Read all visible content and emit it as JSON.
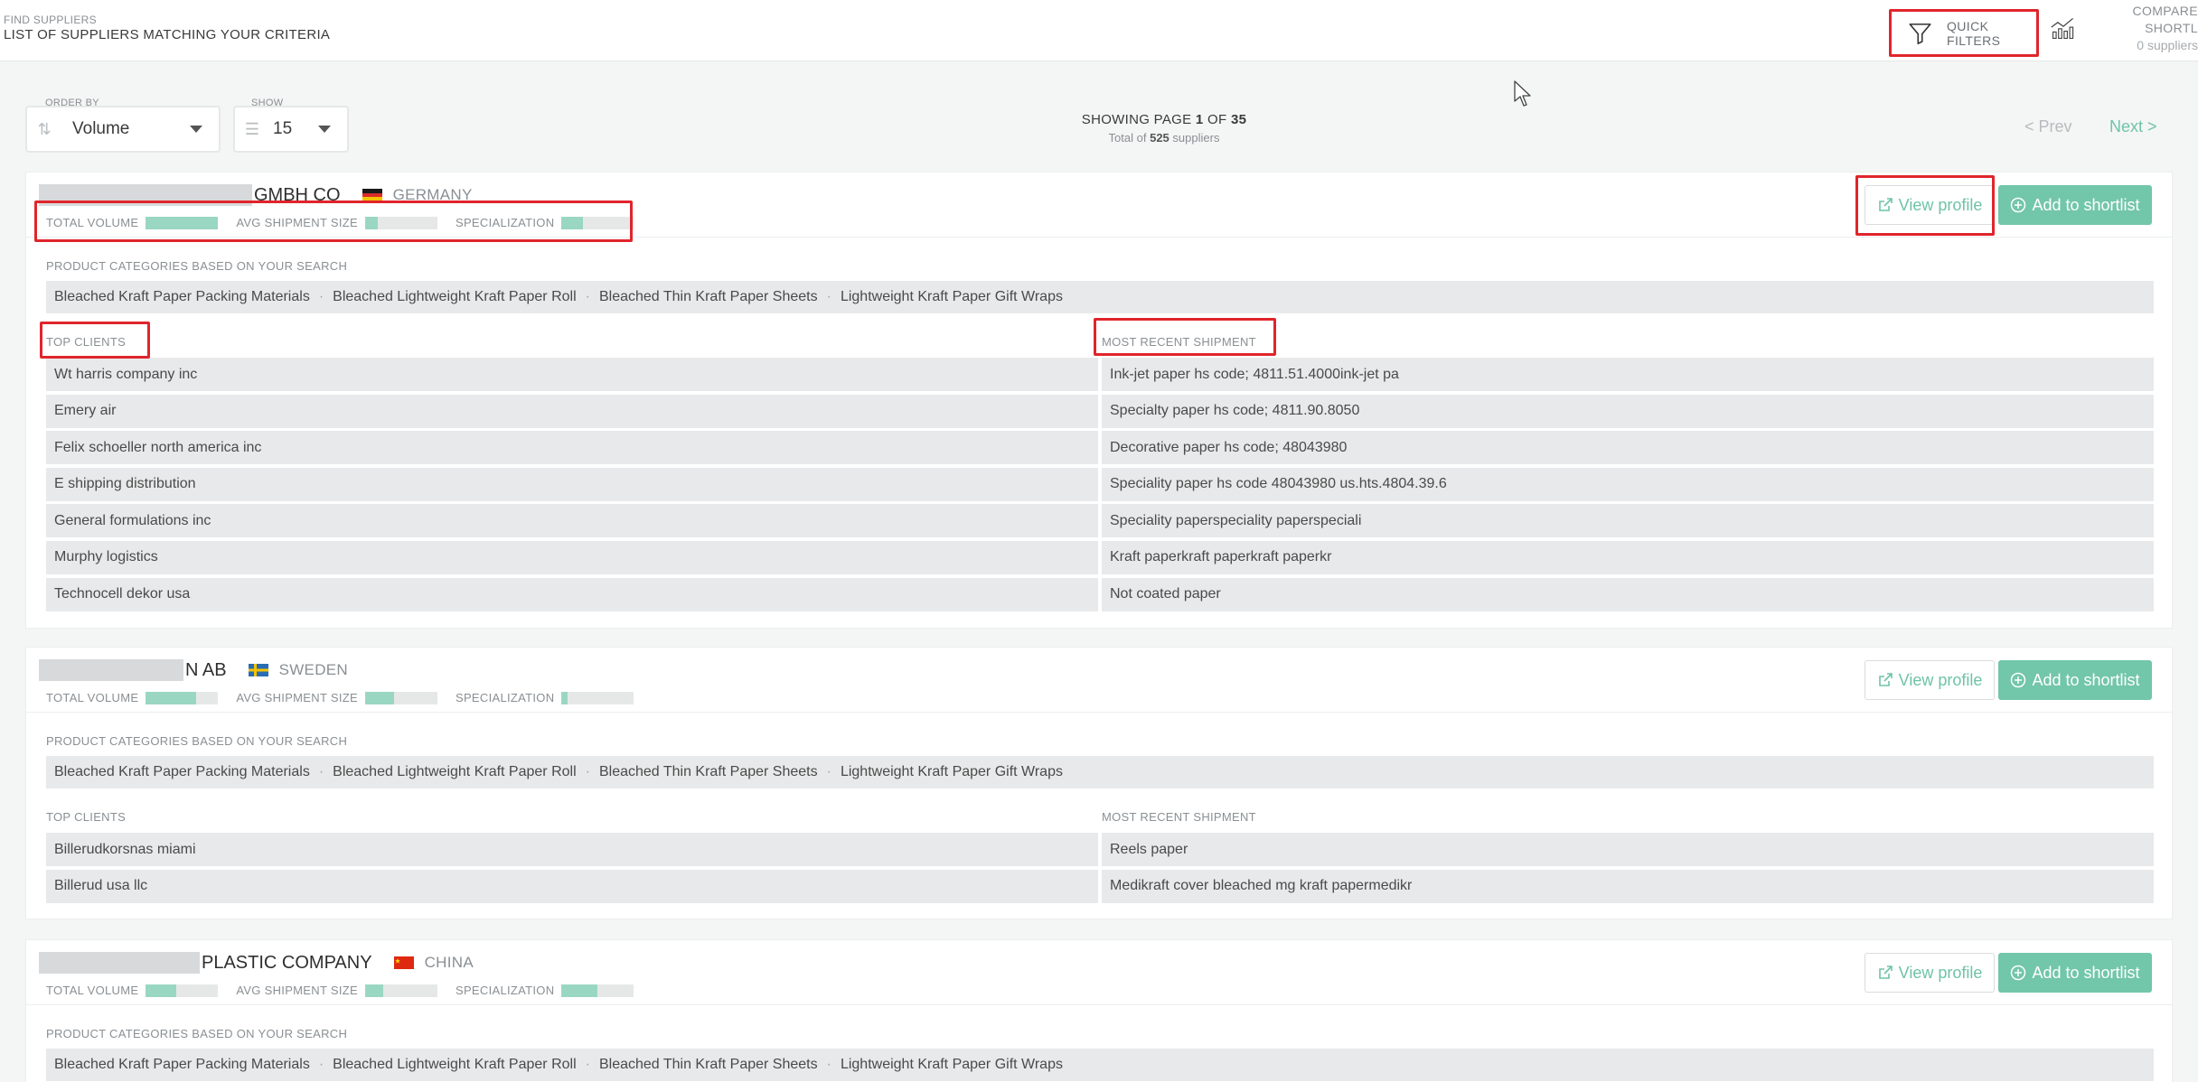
{
  "header": {
    "breadcrumb": "FIND SUPPLIERS",
    "title": "LIST OF SUPPLIERS MATCHING YOUR CRITERIA",
    "quick_filters_label": "QUICK FILTERS",
    "compare_label": "COMPARE SHORTL",
    "compare_count": "0 suppliers"
  },
  "toolbar": {
    "order_by_label": "ORDER BY",
    "order_by_value": "Volume",
    "show_label": "SHOW",
    "show_value": "15",
    "paging_prefix": "SHOWING PAGE",
    "page_current": "1",
    "paging_of": "OF",
    "page_total": "35",
    "total_prefix": "Total of",
    "total_count": "525",
    "total_suffix": "suppliers",
    "prev_label": "< Prev",
    "next_label": "Next >"
  },
  "labels": {
    "total_volume": "TOTAL VOLUME",
    "avg_shipment_size": "AVG SHIPMENT SIZE",
    "specialization": "SPECIALIZATION",
    "product_categories": "PRODUCT CATEGORIES BASED ON YOUR SEARCH",
    "top_clients": "TOP CLIENTS",
    "most_recent_shipment": "MOST RECENT SHIPMENT",
    "view_profile": "View profile",
    "add_to_shortlist": "Add to shortlist"
  },
  "colors": {
    "accent": "#72c6a9",
    "bar_fill": "#9ad7c3",
    "highlight": "#e0252b"
  },
  "suppliers": [
    {
      "name_visible": "GMBH CO",
      "country": "GERMANY",
      "flag": "germany-flag",
      "total_volume": 1.0,
      "avg_shipment_size": 0.18,
      "specialization": 0.3,
      "categories": [
        "Bleached Kraft Paper Packing Materials",
        "Bleached Lightweight Kraft Paper Roll",
        "Bleached Thin Kraft Paper Sheets",
        "Lightweight Kraft Paper Gift Wraps"
      ],
      "top_clients": [
        "Wt harris company inc",
        "Emery air",
        "Felix schoeller north america inc",
        "E shipping distribution",
        "General formulations inc",
        "Murphy logistics",
        "Technocell dekor usa"
      ],
      "recent_shipments": [
        "Ink-jet paper hs code; 4811.51.4000ink-jet pa",
        "Specialty paper hs code; 4811.90.8050",
        "Decorative paper hs code; 48043980",
        "Speciality paper hs code 48043980 us.hts.4804.39.6",
        "Speciality paperspeciality paperspeciali",
        "Kraft paperkraft paperkraft paperkr",
        "Not coated paper"
      ]
    },
    {
      "name_visible": "N AB",
      "country": "SWEDEN",
      "flag": "sweden-flag",
      "total_volume": 0.7,
      "avg_shipment_size": 0.4,
      "specialization": 0.08,
      "categories": [
        "Bleached Kraft Paper Packing Materials",
        "Bleached Lightweight Kraft Paper Roll",
        "Bleached Thin Kraft Paper Sheets",
        "Lightweight Kraft Paper Gift Wraps"
      ],
      "top_clients": [
        "Billerudkorsnas miami",
        "Billerud usa llc"
      ],
      "recent_shipments": [
        "Reels paper",
        "Medikraft cover bleached mg kraft papermedikr"
      ]
    },
    {
      "name_visible": "PLASTIC COMPANY",
      "country": "CHINA",
      "flag": "china-flag",
      "total_volume": 0.42,
      "avg_shipment_size": 0.25,
      "specialization": 0.5,
      "categories": [
        "Bleached Kraft Paper Packing Materials",
        "Bleached Lightweight Kraft Paper Roll",
        "Bleached Thin Kraft Paper Sheets",
        "Lightweight Kraft Paper Gift Wraps"
      ],
      "top_clients": [],
      "recent_shipments": []
    }
  ]
}
